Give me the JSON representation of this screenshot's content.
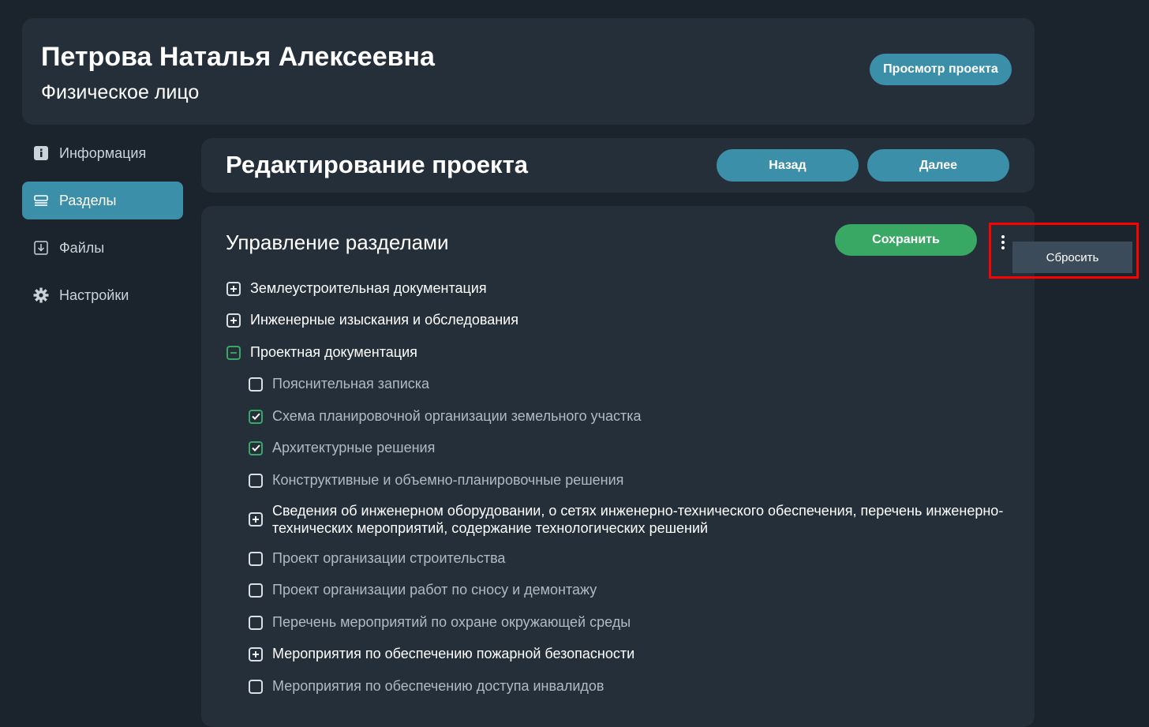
{
  "header": {
    "name": "Петрова Наталья Алексеевна",
    "type": "Физическое лицо",
    "view_project_label": "Просмотр проекта"
  },
  "sidebar": {
    "items": [
      {
        "label": "Информация",
        "icon": "info-icon",
        "active": false
      },
      {
        "label": "Разделы",
        "icon": "list-icon",
        "active": true
      },
      {
        "label": "Файлы",
        "icon": "download-icon",
        "active": false
      },
      {
        "label": "Настройки",
        "icon": "gear-icon",
        "active": false
      }
    ]
  },
  "edit": {
    "title": "Редактирование проекта",
    "back_label": "Назад",
    "next_label": "Далее"
  },
  "sections": {
    "title": "Управление разделами",
    "save_label": "Сохранить",
    "menu": {
      "reset_label": "Сбросить"
    },
    "tree": [
      {
        "label": "Землеустроительная документация",
        "control": "expand-plus"
      },
      {
        "label": "Инженерные изыскания и обследования",
        "control": "expand-plus"
      },
      {
        "label": "Проектная документация",
        "control": "collapse-minus"
      },
      {
        "label": "Пояснительная записка",
        "control": "checkbox",
        "checked": false
      },
      {
        "label": "Схема планировочной организации земельного участка",
        "control": "checkbox",
        "checked": true
      },
      {
        "label": "Архитектурные решения",
        "control": "checkbox",
        "checked": true
      },
      {
        "label": "Конструктивные и объемно-планировочные решения",
        "control": "checkbox",
        "checked": false
      },
      {
        "label": "Сведения об инженерном оборудовании, о сетях инженерно-технического обеспечения, перечень инженерно-технических мероприятий, содержание технологических решений",
        "control": "expand-plus"
      },
      {
        "label": "Проект организации строительства",
        "control": "checkbox",
        "checked": false
      },
      {
        "label": "Проект организации работ по сносу и демонтажу",
        "control": "checkbox",
        "checked": false
      },
      {
        "label": "Перечень мероприятий по охране окружающей среды",
        "control": "checkbox",
        "checked": false
      },
      {
        "label": "Мероприятия по обеспечению пожарной безопасности",
        "control": "expand-plus"
      },
      {
        "label": "Мероприятия по обеспечению доступа инвалидов",
        "control": "checkbox",
        "checked": false
      }
    ]
  },
  "colors": {
    "background": "#1b242c",
    "card": "#252f3a",
    "accent": "#3c8fa9",
    "save": "#3aa865",
    "highlight": "#ff0000"
  }
}
